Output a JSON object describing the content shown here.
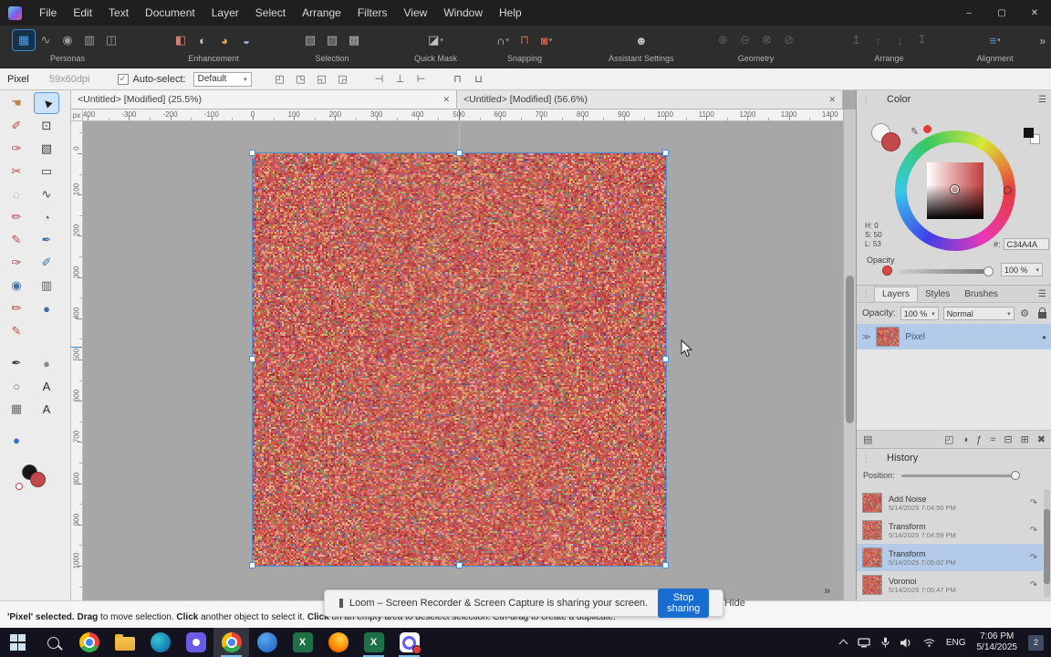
{
  "menubar": {
    "items": [
      "File",
      "Edit",
      "Text",
      "Document",
      "Layer",
      "Select",
      "Arrange",
      "Filters",
      "View",
      "Window",
      "Help"
    ]
  },
  "window_controls": {
    "minimize": "–",
    "restore": "▢",
    "close": "✕"
  },
  "toolbar": {
    "overflow": "»",
    "groups": [
      {
        "label": "Personas",
        "icons": [
          {
            "name": "photo-persona-icon",
            "glyph": "▦",
            "color": "#4f9be8",
            "selected": true
          },
          {
            "name": "liquify-persona-icon",
            "glyph": "∿",
            "color": "#9a9a9a"
          },
          {
            "name": "develop-persona-icon",
            "glyph": "◉",
            "color": "#9a9a9a"
          },
          {
            "name": "tone-mapping-persona-icon",
            "glyph": "▥",
            "color": "#9a9a9a"
          },
          {
            "name": "export-persona-icon",
            "glyph": "◫",
            "color": "#9a9a9a"
          }
        ]
      },
      {
        "label": "Enhancement",
        "icons": [
          {
            "name": "auto-levels-icon",
            "glyph": "◧",
            "color": "#d87a6a"
          },
          {
            "name": "auto-contrast-icon",
            "glyph": "◐",
            "color": "#c8c8c8"
          },
          {
            "name": "auto-colour-icon",
            "glyph": "◕",
            "color": "#e8a84a"
          },
          {
            "name": "auto-white-balance-icon",
            "glyph": "◒",
            "color": "#9ab8d8"
          }
        ]
      },
      {
        "label": "Selection",
        "icons": [
          {
            "name": "select-all-icon",
            "glyph": "▧",
            "color": "#b0b0b0"
          },
          {
            "name": "deselect-icon",
            "glyph": "▨",
            "color": "#b0b0b0"
          },
          {
            "name": "invert-selection-icon",
            "glyph": "▩",
            "color": "#b0b0b0"
          }
        ]
      },
      {
        "label": "Quick Mask",
        "icons": [
          {
            "name": "quick-mask-icon",
            "glyph": "◪",
            "color": "#c0c0c0",
            "dropdown": true
          }
        ]
      },
      {
        "label": "Snapping",
        "icons": [
          {
            "name": "snapping-icon",
            "glyph": "∩",
            "color": "#c8c8c8",
            "dropdown": true
          },
          {
            "name": "snapping-candidates-icon",
            "glyph": "⊓",
            "color": "#d06a5a"
          },
          {
            "name": "force-pixel-alignment-icon",
            "glyph": "◙",
            "color": "#d85a4a",
            "dropdown": true
          }
        ]
      },
      {
        "label": "Assistant Settings",
        "icons": [
          {
            "name": "assistant-icon",
            "glyph": "☻",
            "color": "#c0c0c0"
          }
        ]
      },
      {
        "label": "Geometry",
        "icons": [
          {
            "name": "geometry-add-icon",
            "glyph": "⊕",
            "color": "#5d5d5d"
          },
          {
            "name": "geometry-subtract-icon",
            "glyph": "⊖",
            "color": "#5d5d5d"
          },
          {
            "name": "geometry-intersect-icon",
            "glyph": "⊗",
            "color": "#5d5d5d"
          },
          {
            "name": "geometry-divide-icon",
            "glyph": "⊘",
            "color": "#5d5d5d"
          }
        ]
      },
      {
        "label": "Arrange",
        "icons": [
          {
            "name": "move-to-front-icon",
            "glyph": "↥",
            "color": "#5d5d5d"
          },
          {
            "name": "move-forward-icon",
            "glyph": "↑",
            "color": "#5d5d5d"
          },
          {
            "name": "move-backward-icon",
            "glyph": "↓",
            "color": "#5d5d5d"
          },
          {
            "name": "move-to-back-icon",
            "glyph": "↧",
            "color": "#5d5d5d"
          }
        ]
      },
      {
        "label": "Alignment",
        "icons": [
          {
            "name": "alignment-icon",
            "glyph": "≡",
            "color": "#4f9be8",
            "dropdown": true
          }
        ]
      }
    ]
  },
  "context_bar": {
    "tool_label": "Pixel",
    "dpi": "59x60dpi",
    "auto_select_label": "Auto-select:",
    "auto_select_value": "Default",
    "icon_groups": [
      {
        "name": "transform-anchor-icons",
        "glyphs": [
          "◰",
          "◳",
          "◱",
          "◲"
        ]
      },
      {
        "name": "vertical-align-icons",
        "glyphs": [
          "⊣",
          "⊥",
          "⊢"
        ]
      },
      {
        "name": "distribute-icons",
        "glyphs": [
          "⊓",
          "⊔"
        ]
      }
    ]
  },
  "tabs": [
    {
      "label": "<Untitled> [Modified] (25.5%)"
    },
    {
      "label": "<Untitled> [Modified] (56.6%)"
    }
  ],
  "rulers": {
    "unit": "px",
    "top_labels": [
      -400,
      -300,
      -200,
      -100,
      0,
      100,
      200,
      300,
      400,
      500,
      600,
      700,
      800,
      900,
      1000,
      1100,
      1200,
      1300,
      1400
    ],
    "left_labels": [
      0,
      100,
      200,
      300,
      400,
      500,
      600,
      700,
      800,
      900,
      1000
    ]
  },
  "tools": [
    {
      "name": "view-tool",
      "row": 0,
      "col": 0,
      "glyph": "☚",
      "color": "#b8894a"
    },
    {
      "name": "move-tool",
      "row": 0,
      "col": 1,
      "glyph": "►",
      "color": "#1c1c1c",
      "rot": true,
      "selected": true
    },
    {
      "name": "color-picker-tool",
      "row": 1,
      "col": 0,
      "glyph": "✐",
      "color": "#b84a42"
    },
    {
      "name": "crop-tool",
      "row": 1,
      "col": 1,
      "glyph": "⊡",
      "color": "#3d3d3d"
    },
    {
      "name": "selection-brush-tool",
      "row": 2,
      "col": 0,
      "glyph": "✑",
      "color": "#b84a42"
    },
    {
      "name": "smart-selection-tool",
      "row": 2,
      "col": 1,
      "glyph": "▧",
      "color": "#3d3d3d"
    },
    {
      "name": "blemish-removal-tool",
      "row": 3,
      "col": 0,
      "glyph": "✂",
      "color": "#b84a42"
    },
    {
      "name": "marquee-tool",
      "row": 3,
      "col": 1,
      "glyph": "▭",
      "color": "#3d3d3d"
    },
    {
      "name": "ellipse-marquee-tool",
      "row": 4,
      "col": 0,
      "glyph": "◌",
      "color": "#8a8a8a"
    },
    {
      "name": "lasso-tool",
      "row": 4,
      "col": 1,
      "glyph": "∿",
      "color": "#3d3d3d"
    },
    {
      "name": "paint-brush-tool",
      "row": 5,
      "col": 0,
      "glyph": "✏",
      "color": "#b84a42"
    },
    {
      "name": "flood-select-tool",
      "row": 5,
      "col": 1,
      "glyph": "◔",
      "color": "#3d6fa8"
    },
    {
      "name": "pixel-tool",
      "row": 6,
      "col": 0,
      "glyph": "✎",
      "color": "#b84a42"
    },
    {
      "name": "pen-tool",
      "row": 6,
      "col": 1,
      "glyph": "✒",
      "color": "#3d6fa8"
    },
    {
      "name": "crayon-tool",
      "row": 7,
      "col": 0,
      "glyph": "✑",
      "color": "#b84a42"
    },
    {
      "name": "vector-brush-tool",
      "row": 7,
      "col": 1,
      "glyph": "✐",
      "color": "#3d6fa8"
    },
    {
      "name": "eyedropper-tool",
      "row": 8,
      "col": 0,
      "glyph": "◉",
      "color": "#3d6fa8"
    },
    {
      "name": "gradient-tool",
      "row": 8,
      "col": 1,
      "glyph": "▥",
      "color": "#5d5d5d"
    },
    {
      "name": "erase-brush-tool",
      "row": 9,
      "col": 0,
      "glyph": "✏",
      "color": "#b84a42"
    },
    {
      "name": "flood-fill-tool",
      "row": 9,
      "col": 1,
      "glyph": "●",
      "color": "#3d6fa8"
    },
    {
      "name": "dodge-brush-tool",
      "row": 10,
      "col": 0,
      "glyph": "✎",
      "color": "#b84a42"
    },
    {
      "name": "pen-node-tool",
      "row": 11,
      "col": 0,
      "glyph": "✒",
      "color": "#3d3d3d"
    },
    {
      "name": "ellipse-tool",
      "row": 11,
      "col": 1,
      "glyph": "●",
      "color": "#8a8a8a"
    },
    {
      "name": "shape-tool",
      "row": 12,
      "col": 0,
      "glyph": "○",
      "color": "#6a6a6a"
    },
    {
      "name": "artistic-text-tool",
      "row": 12,
      "col": 1,
      "glyph": "A",
      "color": "#2d2d2d"
    },
    {
      "name": "mesh-warp-tool",
      "row": 13,
      "col": 0,
      "glyph": "▦",
      "color": "#6a6a6a"
    },
    {
      "name": "frame-text-tool",
      "row": 13,
      "col": 1,
      "glyph": "A",
      "color": "#2d2d2d"
    },
    {
      "name": "zoom-tool",
      "row": 14,
      "col": 0,
      "glyph": "●",
      "color": "#2f6fd0"
    }
  ],
  "color_panel": {
    "title": "Color",
    "h": "H: 0",
    "s": "S: 50",
    "l": "L: 53",
    "hex_prefix": "#:",
    "hex": "C34A4A",
    "opacity_label": "Opacity",
    "opacity_value": "100 %",
    "current_color": "#C34A4A"
  },
  "layers_panel": {
    "tabs": [
      "Layers",
      "Styles",
      "Brushes"
    ],
    "opacity_label": "Opacity:",
    "opacity_value": "100 %",
    "blend_mode": "Normal",
    "layers": [
      {
        "name": "Pixel"
      }
    ],
    "footer_icons": [
      {
        "name": "layer-options-icon",
        "glyph": "▤",
        "right": false
      },
      {
        "name": "mask-layer-icon",
        "glyph": "◰",
        "right": true
      },
      {
        "name": "adjustment-layer-icon",
        "glyph": "◑",
        "right": true
      },
      {
        "name": "layer-effects-icon",
        "glyph": "ƒ",
        "right": true
      },
      {
        "name": "live-filter-icon",
        "glyph": "≈",
        "right": true
      },
      {
        "name": "group-layers-icon",
        "glyph": "⊟",
        "right": true
      },
      {
        "name": "add-layer-icon",
        "glyph": "⊞",
        "right": true
      },
      {
        "name": "remove-layer-icon",
        "glyph": "✖",
        "right": true
      }
    ]
  },
  "history_panel": {
    "title": "History",
    "position_label": "Position:",
    "entries": [
      {
        "name": "Add Noise",
        "time": "5/14/2025 7:04:50 PM",
        "selected": false
      },
      {
        "name": "Transform",
        "time": "5/14/2025 7:04:59 PM",
        "selected": false
      },
      {
        "name": "Transform",
        "time": "5/14/2025 7:05:02 PM",
        "selected": true
      },
      {
        "name": "Voronoi",
        "time": "5/14/2025 7:05:47 PM",
        "selected": false
      }
    ]
  },
  "notification": {
    "text": "Loom – Screen Recorder & Screen Capture is sharing your screen.",
    "stop_label": "Stop sharing",
    "hide_label": "Hide"
  },
  "status_bar": {
    "segments": [
      {
        "t": "'Pixel' selected. ",
        "b": true
      },
      {
        "t": "Drag",
        "b": true
      },
      {
        "t": " to move selection. ",
        "b": false
      },
      {
        "t": "Click",
        "b": true
      },
      {
        "t": " another object to select it. ",
        "b": false
      },
      {
        "t": "Click",
        "b": true
      },
      {
        "t": " on an empty area to deselect selection. Ctrl-drag to create a duplicate.",
        "b": false
      }
    ]
  },
  "taskbar": {
    "icons": [
      {
        "name": "start-button",
        "type": "start"
      },
      {
        "name": "search-button",
        "type": "search"
      },
      {
        "name": "chrome-icon",
        "type": "chrome"
      },
      {
        "name": "file-explorer-icon",
        "type": "folder"
      },
      {
        "name": "edge-icon",
        "type": "edge"
      },
      {
        "name": "store-app-icon",
        "type": "purple"
      },
      {
        "name": "chrome-active-icon",
        "type": "chrome",
        "active": true,
        "open": true
      },
      {
        "name": "outlook-icon",
        "type": "blue"
      },
      {
        "name": "excel-icon",
        "type": "excel"
      },
      {
        "name": "firefox-icon",
        "type": "firefox"
      },
      {
        "name": "excel-window-icon",
        "type": "excel",
        "open": true
      },
      {
        "name": "loom-icon",
        "type": "loom",
        "open": true
      }
    ],
    "tray": {
      "lang": "ENG",
      "time": "7:06 PM",
      "date": "5/14/2025",
      "badge": "2"
    }
  },
  "canvas": {
    "selection_color": "#4a90d9",
    "noise_palette": [
      "#c24b45",
      "#b93f3f",
      "#d05a52",
      "#c85550",
      "#d96a60",
      "#b03a44",
      "#e07a72",
      "#cc4f5a",
      "#d8626e",
      "#e68a80",
      "#a93838",
      "#c44848",
      "#d45550",
      "#bf4a40",
      "#e0958d",
      "#c86a45",
      "#d98a55",
      "#e0a868",
      "#b87a40",
      "#8f9a50",
      "#6f9a58",
      "#5878a8",
      "#8860a8",
      "#d8c070",
      "#e8b0a8",
      "#983040",
      "#c05878",
      "#d07048",
      "#c24b45",
      "#d05a52",
      "#c85550",
      "#d96a60",
      "#cc4f5a",
      "#e68a80",
      "#c44848",
      "#d45550"
    ]
  }
}
